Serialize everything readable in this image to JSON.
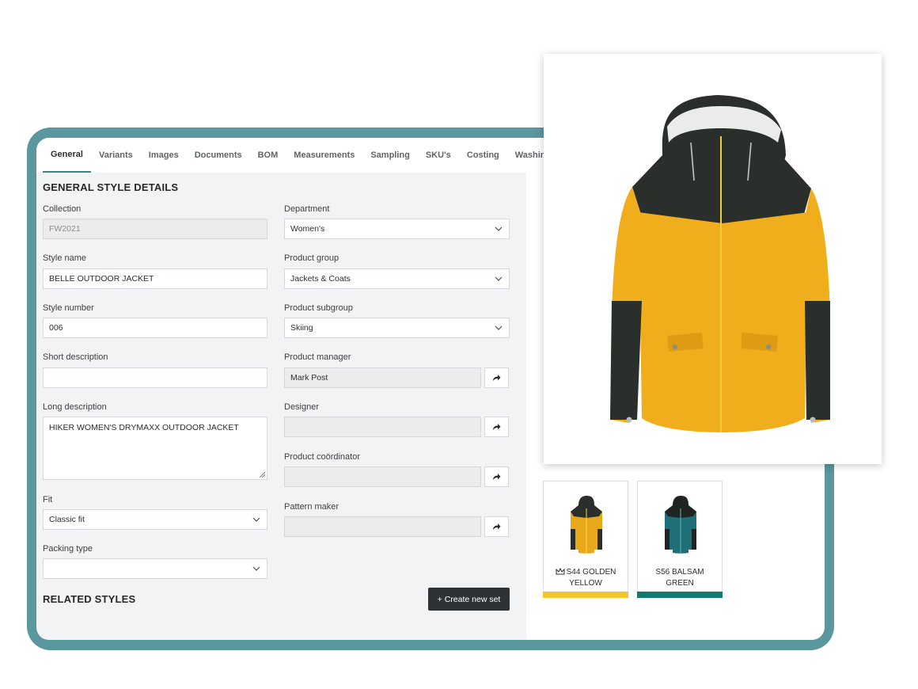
{
  "tabs": [
    {
      "label": "General",
      "active": true
    },
    {
      "label": "Variants"
    },
    {
      "label": "Images"
    },
    {
      "label": "Documents"
    },
    {
      "label": "BOM"
    },
    {
      "label": "Measurements"
    },
    {
      "label": "Sampling"
    },
    {
      "label": "SKU's"
    },
    {
      "label": "Costing"
    },
    {
      "label": "Washing ins"
    }
  ],
  "form": {
    "section_title": "GENERAL STYLE DETAILS",
    "collection": {
      "label": "Collection",
      "value": "FW2021"
    },
    "style_name": {
      "label": "Style name",
      "value": "BELLE OUTDOOR JACKET"
    },
    "style_number": {
      "label": "Style number",
      "value": "006"
    },
    "short_description": {
      "label": "Short description",
      "value": ""
    },
    "long_description": {
      "label": "Long description",
      "value": "HIKER WOMEN'S DRYMAXX OUTDOOR JACKET"
    },
    "fit": {
      "label": "Fit",
      "value": "Classic fit"
    },
    "packing_type": {
      "label": "Packing type",
      "value": ""
    },
    "department": {
      "label": "Department",
      "value": "Women's"
    },
    "product_group": {
      "label": "Product group",
      "value": "Jackets & Coats"
    },
    "product_subgroup": {
      "label": "Product subgroup",
      "value": "Skiing"
    },
    "product_manager": {
      "label": "Product manager",
      "value": "Mark Post"
    },
    "designer": {
      "label": "Designer",
      "value": ""
    },
    "product_coordinator": {
      "label": "Product coördinator",
      "value": ""
    },
    "pattern_maker": {
      "label": "Pattern maker",
      "value": ""
    }
  },
  "related": {
    "title": "RELATED STYLES",
    "create_button": "+ Create new set"
  },
  "variants": [
    {
      "label": "S44 GOLDEN YELLOW",
      "color": "#f2c62e",
      "body_color": "#e8a919",
      "primary": true
    },
    {
      "label": "S56 BALSAM GREEN",
      "color": "#0f7a6e",
      "body_color": "#1e6f78",
      "primary": false
    }
  ],
  "colors": {
    "frame": "#5a979e",
    "accent_tab": "#3f8088",
    "jacket_yellow": "#f0ae1c",
    "jacket_dark": "#2b2f2b"
  },
  "icons": {
    "dropdown": "chevron-down-icon",
    "assign": "share-arrow-icon",
    "primary_variant": "crown-icon"
  }
}
